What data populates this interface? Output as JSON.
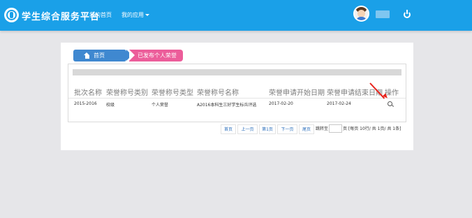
{
  "header": {
    "brand": "学生综合服务平台",
    "nav": {
      "home": "我的首页",
      "apps": "我的应用"
    }
  },
  "breadcrumb": {
    "home": "首页",
    "current": "已发布个人荣誉"
  },
  "table": {
    "columns": [
      "批次名称",
      "荣誉称号类别",
      "荣誉称号类型",
      "荣誉称号名称",
      "荣誉申请开始日期",
      "荣誉申请结束日期",
      "操作"
    ],
    "rows": [
      {
        "batch": "2015-2016",
        "category": "校级",
        "type": "个人荣誉",
        "name": "A2016本科生三好学生标兵评选",
        "start": "2017-02-20",
        "end": "2017-02-24"
      }
    ]
  },
  "pagination": {
    "first": "首页",
    "prev": "上一页",
    "page": "第1页",
    "next": "下一页",
    "last": "尾页",
    "goto": "跳转至",
    "summary": "页 [每页 10行/ 共 1页/ 共 1条]"
  },
  "colors": {
    "navbar": "#1aa0e8",
    "breadcrumb_home": "#3f88d0",
    "breadcrumb_current": "#ec5d9a",
    "annotation_arrow": "#e8231c"
  },
  "icons": {
    "logo": "logo-icon",
    "home": "home-icon",
    "view": "magnifier-icon",
    "logout": "power-icon"
  }
}
